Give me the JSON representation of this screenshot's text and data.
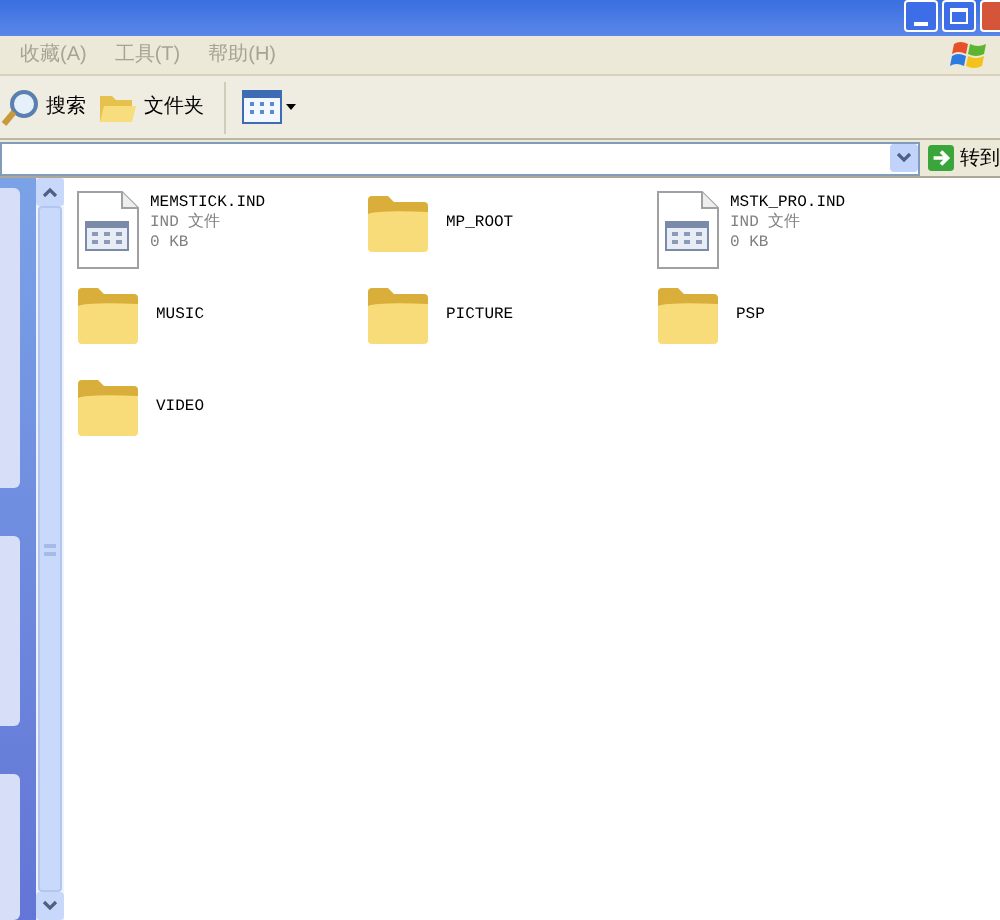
{
  "menu": [
    {
      "label": "收藏(A)"
    },
    {
      "label": "工具(T)"
    },
    {
      "label": "帮助(H)"
    }
  ],
  "toolbar": [
    {
      "kind": "search",
      "label": "搜索"
    },
    {
      "kind": "folders",
      "label": "文件夹"
    },
    {
      "kind": "views"
    }
  ],
  "address_bar": {
    "go_label": "转到"
  },
  "files": [
    {
      "kind": "file",
      "name": "MEMSTICK.IND",
      "type": "IND 文件",
      "size": "0 KB"
    },
    {
      "kind": "folder",
      "name": "MP_ROOT"
    },
    {
      "kind": "file",
      "name": "MSTK_PRO.IND",
      "type": "IND 文件",
      "size": "0 KB"
    },
    {
      "kind": "folder",
      "name": "MUSIC"
    },
    {
      "kind": "folder",
      "name": "PICTURE"
    },
    {
      "kind": "folder",
      "name": "PSP"
    },
    {
      "kind": "folder",
      "name": "VIDEO"
    }
  ]
}
